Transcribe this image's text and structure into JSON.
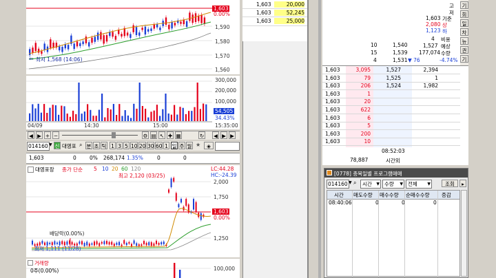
{
  "chart1": {
    "price_tag": "1,603",
    "pct_tag": "0.00%",
    "yticks": [
      "1,590",
      "1,580",
      "1,570",
      "1,560"
    ],
    "low_label": "최저 1,568 (14:06)"
  },
  "volume1": {
    "yticks": [
      "300,000",
      "200,000",
      "100,000"
    ],
    "vol_tag": "54,505",
    "pct_tag": "34.43%"
  },
  "time_axis": [
    "04/09",
    "14:30",
    "15:00",
    "15:35:00"
  ],
  "toolbar2": {
    "code": "014160",
    "mode_btn": "신",
    "name": "대영포",
    "period_btns": [
      "분",
      "초",
      "틱",
      "1",
      "3",
      "5",
      "10",
      "20",
      "30",
      "60",
      "1",
      "일",
      "주",
      "월"
    ],
    "star": "★"
  },
  "quote_row": {
    "price": "1,603",
    "change": "0",
    "rate": "0%",
    "volume": "268,174",
    "ratio": "1.35%",
    "v1": "0",
    "v2": "0"
  },
  "chart2": {
    "title": "대영포장",
    "legend_prefix": "종가 단순",
    "ma_periods": [
      "5",
      "10",
      "20",
      "60",
      "120"
    ],
    "high_label": "최고 2,120 (03/25)",
    "lc_label": "LC:44.28",
    "hc_label": "HC:-24.39",
    "price_tag": "1,603",
    "pct_tag": "0.00%",
    "yticks": [
      "2,000",
      "1,750",
      "1,250"
    ],
    "dividend_label": "배당락(0.00%)",
    "low_label": "최저 1,111 (11/28)",
    "volume_title": "거래량",
    "volume_sub": "0주(0.00%)",
    "volume_tick": "100,000"
  },
  "orderbook_top": {
    "rows": [
      {
        "price": "1,603",
        "qty": "20,000"
      },
      {
        "price": "1,603",
        "qty": "52,245"
      },
      {
        "price": "1,603",
        "qty": "25,000"
      }
    ]
  },
  "ask_side": {
    "rows": [
      {
        "cnt": "10",
        "price": "1,540"
      },
      {
        "cnt": "15",
        "price": "1,539"
      },
      {
        "cnt": "4",
        "price": "1,531"
      }
    ]
  },
  "expected_info": {
    "top_chars": [
      "고",
      "저",
      "기준"
    ],
    "vals": [
      "1,603",
      "2,080",
      "1,123"
    ],
    "vals_suffix": [
      "기준",
      "상",
      "하"
    ],
    "label_rows": [
      {
        "val": "4",
        "label": "비용"
      },
      {
        "val": "1,527",
        "label": "예상"
      },
      {
        "val": "177,074",
        "label": "수량"
      },
      {
        "val": "▼ 76",
        "label": "-4.74%"
      }
    ],
    "side_tabs": [
      "기",
      "회",
      "일",
      "차",
      "뉴",
      "권",
      "기"
    ]
  },
  "bid_side": {
    "rows": [
      {
        "price": "1,603",
        "qty": "3,095",
        "p2": "1,527",
        "q2": "2,394"
      },
      {
        "price": "1,603",
        "qty": "79",
        "p2": "1,525",
        "q2": "1"
      },
      {
        "price": "1,603",
        "qty": "206",
        "p2": "1,524",
        "q2": "1,982"
      },
      {
        "price": "1,603",
        "qty": "1",
        "p2": "",
        "q2": ""
      },
      {
        "price": "1,603",
        "qty": "20",
        "p2": "",
        "q2": ""
      },
      {
        "price": "1,603",
        "qty": "622",
        "p2": "",
        "q2": ""
      },
      {
        "price": "1,603",
        "qty": "6",
        "p2": "",
        "q2": ""
      },
      {
        "price": "1,603",
        "qty": "5",
        "p2": "",
        "q2": ""
      },
      {
        "price": "1,603",
        "qty": "200",
        "p2": "",
        "q2": ""
      },
      {
        "price": "1,603",
        "qty": "10",
        "p2": "",
        "q2": ""
      }
    ]
  },
  "summary": {
    "time": "08:52:03",
    "total": "78,887",
    "label": "시간외"
  },
  "program_window": {
    "title": "[0778] 종목일별 프로그램매매",
    "code": "014160",
    "sel_time": "시간",
    "sel_qty": "수량",
    "sel_all": "전체",
    "query_btn": "조회",
    "headers": [
      "시간",
      "매도수량",
      "매수수량",
      "순매수수량",
      "증감"
    ],
    "rows": [
      {
        "time": "08:40:06",
        "sell": "0",
        "buy": "0",
        "net": "0",
        "chg": ""
      }
    ]
  }
}
